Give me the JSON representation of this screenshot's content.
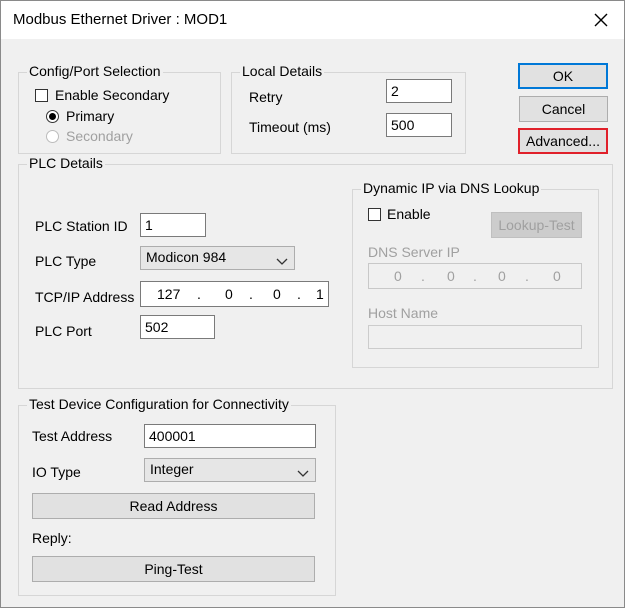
{
  "window": {
    "title": "Modbus Ethernet Driver : MOD1"
  },
  "config_port": {
    "label": "Config/Port Selection",
    "enable_secondary": "Enable Secondary",
    "primary": "Primary",
    "secondary": "Secondary"
  },
  "local_details": {
    "label": "Local Details",
    "retry_label": "Retry",
    "retry_value": "2",
    "timeout_label": "Timeout (ms)",
    "timeout_value": "500"
  },
  "buttons": {
    "ok": "OK",
    "cancel": "Cancel",
    "advanced": "Advanced..."
  },
  "plc_details": {
    "label": "PLC Details",
    "station_label": "PLC Station ID",
    "station_value": "1",
    "type_label": "PLC Type",
    "type_value": "Modicon 984",
    "ip_label": "TCP/IP Address",
    "ip_octets": [
      "127",
      "0",
      "0",
      "1"
    ],
    "port_label": "PLC Port",
    "port_value": "502"
  },
  "dynamic_ip": {
    "label": "Dynamic IP via DNS Lookup",
    "enable": "Enable",
    "lookup_test": "Lookup-Test",
    "dns_label": "DNS Server IP",
    "dns_octets": [
      "0",
      "0",
      "0",
      "0"
    ],
    "host_label": "Host Name",
    "host_value": ""
  },
  "test_device": {
    "label": "Test Device Configuration for Connectivity",
    "address_label": "Test Address",
    "address_value": "400001",
    "io_type_label": "IO Type",
    "io_type_value": "Integer",
    "read_address": "Read Address",
    "reply_label": "Reply:",
    "ping_test": "Ping-Test"
  }
}
